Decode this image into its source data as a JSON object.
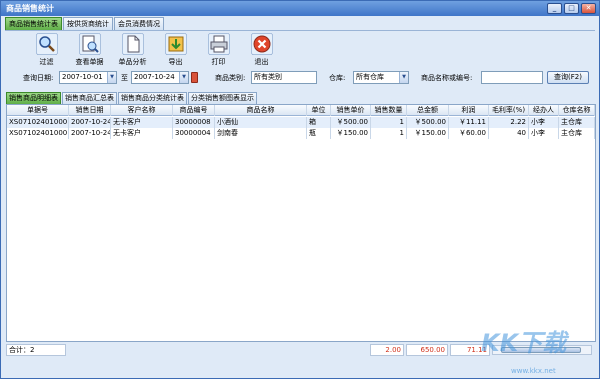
{
  "window": {
    "title": "商品销售统计",
    "min": "_",
    "max": "□",
    "close": "✕"
  },
  "top_tabs": [
    "商品销售统计表",
    "按供货商统计",
    "会员消费情况"
  ],
  "toolbar": [
    {
      "label": "过滤",
      "icon": "magnifier-icon"
    },
    {
      "label": "查看单据",
      "icon": "document-search-icon"
    },
    {
      "label": "单品分析",
      "icon": "document-icon"
    },
    {
      "label": "导出",
      "icon": "export-icon"
    },
    {
      "label": "打印",
      "icon": "printer-icon"
    },
    {
      "label": "退出",
      "icon": "exit-icon"
    }
  ],
  "filters": {
    "date_label": "查询日期:",
    "date_from": "2007-10-01",
    "to_label": "至",
    "date_to": "2007-10-24",
    "category_label": "商品类别:",
    "category_value": "所有类别",
    "warehouse_label": "仓库:",
    "warehouse_value": "所有仓库",
    "name_label": "商品名称或编号:",
    "name_value": "",
    "query_button": "查询(F2)"
  },
  "sub_tabs": [
    "销售商品明细表",
    "销售商品汇总表",
    "销售商品分类统计表",
    "分类销售额图表显示"
  ],
  "table": {
    "headers": [
      "单据号",
      "销售日期",
      "客户名称",
      "商品编号",
      "商品名称",
      "单位",
      "销售单价",
      "销售数量",
      "总金额",
      "利润",
      "毛利率(%)",
      "经办人",
      "仓库名称"
    ],
    "rows": [
      [
        "XS071024010001",
        "2007-10-24",
        "无卡客户",
        "30000008",
        "小酒仙",
        "箱",
        "￥500.00",
        "1",
        "￥500.00",
        "￥11.11",
        "2.22",
        "小李",
        "主仓库"
      ],
      [
        "XS071024010001",
        "2007-10-24",
        "无卡客户",
        "30000004",
        "剑南春",
        "瓶",
        "￥150.00",
        "1",
        "￥150.00",
        "￥60.00",
        "40",
        "小李",
        "主仓库"
      ]
    ]
  },
  "footer": {
    "total_label": "合计：2",
    "qty_total": "2.00",
    "amount_total": "650.00",
    "profit_total": "71.11"
  },
  "watermark": {
    "text": "KK下载",
    "url": "www.kkx.net"
  },
  "colors": {
    "accent_green": "#5fae47",
    "title_blue": "#3f75c8",
    "total_red": "#d0311b"
  }
}
